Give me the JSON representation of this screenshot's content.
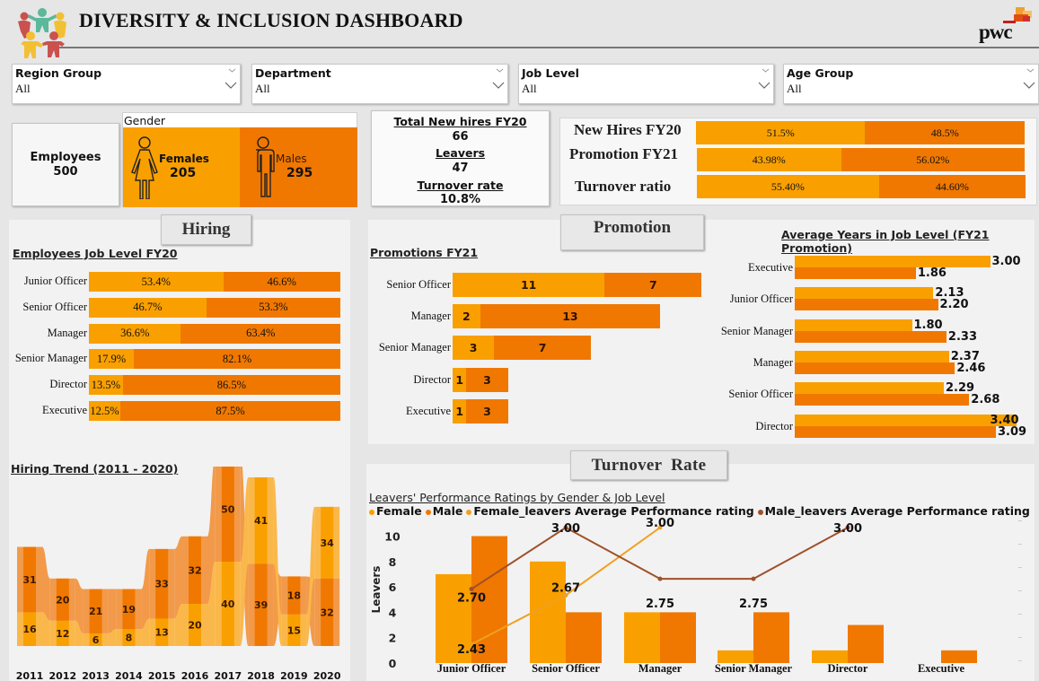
{
  "header": {
    "title": "DIVERSITY & INCLUSION DASHBOARD",
    "logo_icon": "people-circle-logo",
    "brand": "pwc"
  },
  "colors": {
    "female": "#f9a000",
    "male": "#f07800",
    "female_line": "#f0a020",
    "male_line": "#a0502a",
    "ribbon_female": "#fbb84a",
    "ribbon_male": "#f29a4a"
  },
  "slicers": [
    {
      "label": "Region Group",
      "value": "All"
    },
    {
      "label": "Department",
      "value": "All"
    },
    {
      "label": "Job Level",
      "value": "All"
    },
    {
      "label": "Age Group",
      "value": "All"
    }
  ],
  "employees": {
    "label": "Employees",
    "value": "500"
  },
  "gender": {
    "title": "Gender",
    "female_label": "Females",
    "female_value": "205",
    "male_label": "Males",
    "male_value": "295"
  },
  "kpis": {
    "new_hires_label": "Total New hires FY20",
    "new_hires_value": "66",
    "leavers_label": "Leavers",
    "leavers_value": "47",
    "turnover_label": "Turnover rate",
    "turnover_value": "10.8%"
  },
  "ratios": [
    {
      "label": "New Hires FY20",
      "female": 51.5,
      "male": 48.5,
      "female_text": "51.5%",
      "male_text": "48.5%"
    },
    {
      "label": "Promotion FY21",
      "female": 43.98,
      "male": 56.02,
      "female_text": "43.98%",
      "male_text": "56.02%"
    },
    {
      "label": "Turnover ratio",
      "female": 55.4,
      "male": 44.6,
      "female_text": "55.40%",
      "male_text": "44.60%"
    }
  ],
  "sections": {
    "hiring": "Hiring",
    "promotion": "Promotion",
    "turnover": "Turnover  Rate"
  },
  "chart_data": [
    {
      "id": "employees_job_level",
      "type": "bar",
      "orientation": "horizontal-100%-stacked",
      "title": "Employees Job Level FY20",
      "categories": [
        "Junior Officer",
        "Senior Officer",
        "Manager",
        "Senior Manager",
        "Director",
        "Executive"
      ],
      "series": [
        {
          "name": "Female",
          "values": [
            53.4,
            46.7,
            36.6,
            17.9,
            13.5,
            12.5
          ]
        },
        {
          "name": "Male",
          "values": [
            46.6,
            53.3,
            63.4,
            82.1,
            86.5,
            87.5
          ]
        }
      ]
    },
    {
      "id": "hiring_trend",
      "type": "area",
      "subtype": "ribbon",
      "title": "Hiring Trend (2011 - 2020)",
      "categories": [
        "2011",
        "2012",
        "2013",
        "2014",
        "2015",
        "2016",
        "2017",
        "2018",
        "2019",
        "2020"
      ],
      "series": [
        {
          "name": "Female",
          "values": [
            16,
            12,
            6,
            8,
            13,
            20,
            40,
            41,
            15,
            34
          ]
        },
        {
          "name": "Male",
          "values": [
            31,
            20,
            21,
            19,
            33,
            32,
            50,
            39,
            18,
            32
          ]
        }
      ]
    },
    {
      "id": "promotions_fy21",
      "type": "bar",
      "orientation": "horizontal-stacked",
      "title": "Promotions FY21",
      "categories": [
        "Senior Officer",
        "Manager",
        "Senior Manager",
        "Director",
        "Executive"
      ],
      "series": [
        {
          "name": "Female",
          "values": [
            11,
            2,
            3,
            1,
            1
          ]
        },
        {
          "name": "Male",
          "values": [
            7,
            13,
            7,
            3,
            3
          ]
        }
      ]
    },
    {
      "id": "avg_years_job_level",
      "type": "bar",
      "orientation": "horizontal-clustered",
      "title": "Average Years in Job Level (FY21 Promotion)",
      "categories": [
        "Executive",
        "Junior Officer",
        "Senior Manager",
        "Manager",
        "Senior Officer",
        "Director"
      ],
      "series": [
        {
          "name": "Female",
          "values": [
            3.0,
            2.13,
            1.8,
            2.37,
            2.29,
            3.4
          ]
        },
        {
          "name": "Male",
          "values": [
            1.86,
            2.2,
            2.33,
            2.46,
            2.68,
            3.09
          ]
        }
      ],
      "xlim": [
        0,
        3.6
      ]
    },
    {
      "id": "leavers_performance",
      "type": "bar",
      "subtype": "clustered-bar-with-lines",
      "title": "Leavers' Performance Ratings by Gender & Job Level",
      "legend": [
        "Female",
        "Male",
        "Female_leavers Average Performance rating",
        "Male_leavers Average Performance rating"
      ],
      "legend_position": "top-left",
      "ylabel": "Leavers",
      "ylim": [
        0,
        10
      ],
      "yticks": [
        "0",
        "2",
        "4",
        "6",
        "8",
        "10"
      ],
      "categories": [
        "Junior Officer",
        "Senior Officer",
        "Manager",
        "Senior Manager",
        "Director",
        "Executive"
      ],
      "series": [
        {
          "name": "Female",
          "values": [
            7,
            8,
            4,
            1,
            1,
            0
          ]
        },
        {
          "name": "Male",
          "values": [
            10,
            4,
            4,
            4,
            3,
            1
          ]
        }
      ],
      "lines": [
        {
          "name": "Female_leavers Average Performance rating",
          "values": [
            2.43,
            2.67,
            3.0,
            null,
            null,
            null
          ],
          "labels": [
            "2.43",
            "2.67",
            "3.00"
          ]
        },
        {
          "name": "Male_leavers Average Performance rating",
          "values": [
            2.7,
            3.0,
            2.75,
            2.75,
            3.0,
            null
          ],
          "labels": [
            "2.70",
            "3.00",
            "2.75",
            "2.75",
            "3.00"
          ]
        }
      ]
    }
  ]
}
